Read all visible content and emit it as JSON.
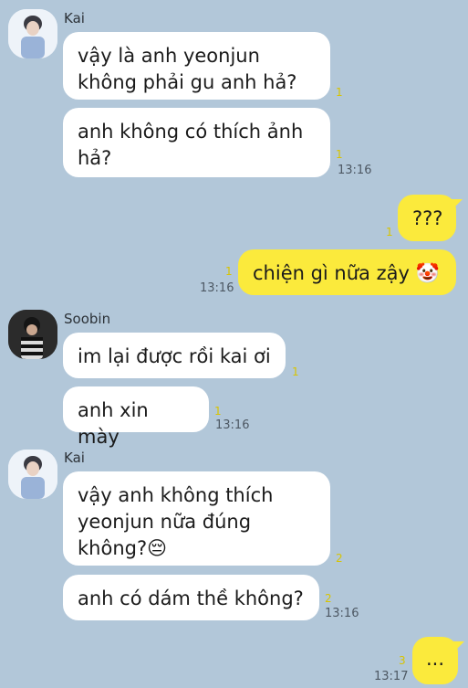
{
  "messages": [
    {
      "sender": "Kai",
      "text": "vậy là anh yeonjun\nkhông phải gu anh hả?",
      "unread": "1"
    },
    {
      "text": "anh không có thích ảnh\nhả?",
      "unread": "1",
      "time": "13:16"
    },
    {
      "me": true,
      "text": "???",
      "unread": "1"
    },
    {
      "me": true,
      "text": "chiện gì nữa zậy 🤡",
      "unread": "1",
      "time": "13:16"
    },
    {
      "sender": "Soobin",
      "text": "im lại được rồi kai ơi",
      "unread": "1"
    },
    {
      "text": "anh xin mày",
      "unread": "1",
      "time": "13:16"
    },
    {
      "sender": "Kai",
      "text": "vậy anh không thích\nyeonjun nữa đúng\nkhông?😔",
      "unread": "2"
    },
    {
      "text": "anh có dám thề không?",
      "unread": "2",
      "time": "13:16"
    },
    {
      "me": true,
      "text": "...",
      "unread": "3",
      "time": "13:17"
    }
  ],
  "colors": {
    "background": "#b2c7d9",
    "my_bubble": "#fbea3c",
    "other_bubble": "#ffffff",
    "unread": "#d8c400"
  }
}
